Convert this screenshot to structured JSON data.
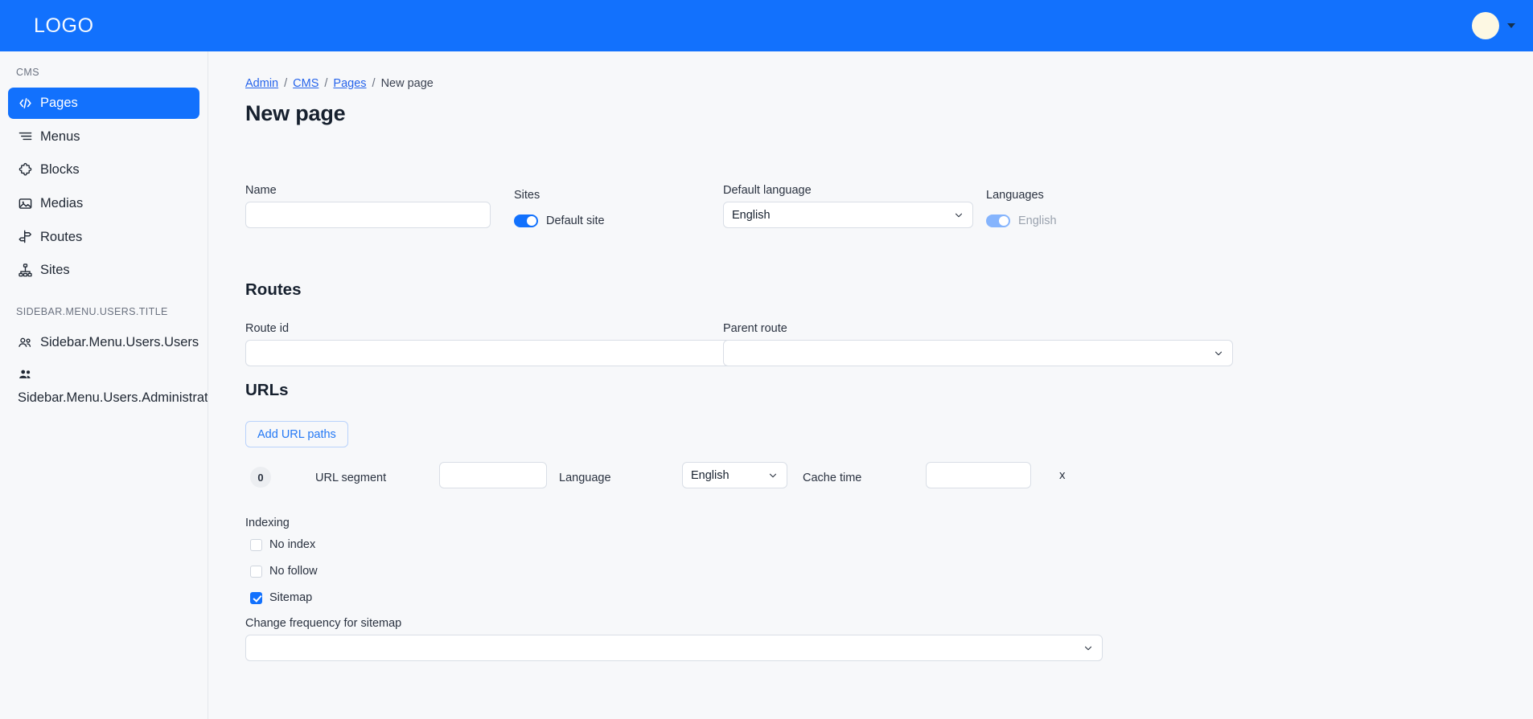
{
  "topbar": {
    "logo": "LOGO",
    "avatar_icon": "user-avatar",
    "caret_icon": "chevron-down-icon"
  },
  "sidebar": {
    "sections": [
      {
        "title": "CMS",
        "items": [
          {
            "label": "Pages",
            "icon": "code-brackets-icon",
            "active": true
          },
          {
            "label": "Menus",
            "icon": "menu-lines-icon",
            "active": false
          },
          {
            "label": "Blocks",
            "icon": "puzzle-piece-icon",
            "active": false
          },
          {
            "label": "Medias",
            "icon": "image-icon",
            "active": false
          },
          {
            "label": "Routes",
            "icon": "signpost-icon",
            "active": false
          },
          {
            "label": "Sites",
            "icon": "sitemap-icon",
            "active": false
          }
        ]
      },
      {
        "title": "SIDEBAR.MENU.USERS.TITLE",
        "items": [
          {
            "label": "Sidebar.Menu.Users.Users",
            "icon": "users-outline-icon",
            "active": false
          },
          {
            "label": "Sidebar.Menu.Users.Administrators",
            "icon": "users-solid-icon",
            "active": false,
            "wrap": true
          }
        ]
      }
    ]
  },
  "breadcrumb": {
    "items": [
      {
        "label": "Admin",
        "link": true
      },
      {
        "label": "CMS",
        "link": true
      },
      {
        "label": "Pages",
        "link": true
      },
      {
        "label": "New page",
        "link": false
      }
    ],
    "separator": "/"
  },
  "page": {
    "title": "New page"
  },
  "form": {
    "name": {
      "label": "Name",
      "value": "",
      "placeholder": ""
    },
    "sites": {
      "label": "Sites",
      "toggle_label": "Default site",
      "toggle_on": true
    },
    "default_language": {
      "label": "Default language",
      "value": "English",
      "chevron_icon": "chevron-down-icon"
    },
    "languages": {
      "label": "Languages",
      "toggle_label": "English",
      "toggle_on": true,
      "disabled": true
    }
  },
  "routes": {
    "heading": "Routes",
    "route_id": {
      "label": "Route id",
      "value": "",
      "placeholder": ""
    },
    "parent_route": {
      "label": "Parent route",
      "value": "",
      "chevron_icon": "chevron-down-icon"
    }
  },
  "urls": {
    "heading": "URLs",
    "add_button": "Add URL paths",
    "rows": [
      {
        "index": "0",
        "url_segment_label": "URL segment",
        "url_segment_value": "",
        "language_label": "Language",
        "language_value": "English",
        "language_chevron_icon": "chevron-down-icon",
        "cache_time_label": "Cache time",
        "cache_time_value": "",
        "remove_label": "x"
      }
    ]
  },
  "indexing": {
    "label": "Indexing",
    "options": [
      {
        "label": "No index",
        "checked": false
      },
      {
        "label": "No follow",
        "checked": false
      },
      {
        "label": "Sitemap",
        "checked": true
      }
    ],
    "change_frequency": {
      "label": "Change frequency for sitemap",
      "value": "",
      "chevron_icon": "chevron-down-icon"
    }
  },
  "colors": {
    "brand_blue": "#1271fd",
    "link_blue": "#2563eb",
    "page_bg": "#f7f8fa",
    "avatar": "#fdf8e3"
  }
}
